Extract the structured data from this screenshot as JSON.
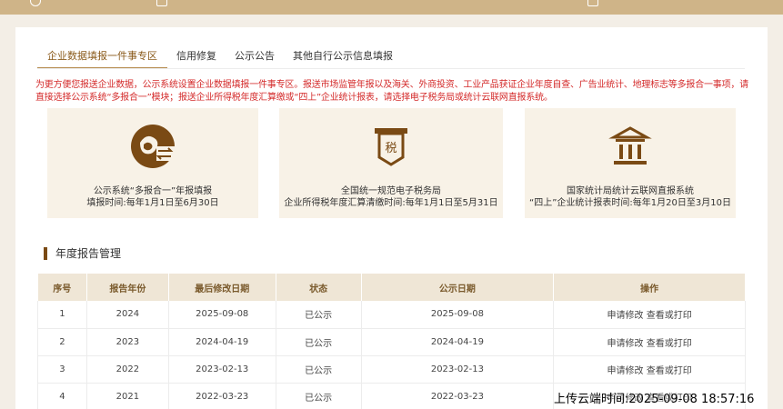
{
  "tabs": [
    "企业数据填报一件事专区",
    "信用修复",
    "公示公告",
    "其他自行公示信息填报"
  ],
  "notice": "为更方便您报送企业数据，公示系统设置企业数据填报一件事专区。报送市场监管年报以及海关、外商投资、工业产品获证企业年度自查、广告业统计、地理标志等多报合一事项，请直接选择公示系统“多报合一”模块；报送企业所得税年度汇算缴或“四上”企业统计报表，请选择电子税务局或统计云联网直报系统。",
  "services": [
    {
      "icon": "multi-report-icon",
      "line1": "公示系统“多报合一”年报填报",
      "line2": "填报时间:每年1月1日至6月30日"
    },
    {
      "icon": "tax-icon",
      "line1": "全国统一规范电子税务局",
      "line2": "企业所得税年度汇算清缴时间:每年1月1日至5月31日"
    },
    {
      "icon": "statistics-bureau-icon",
      "line1": "国家统计局统计云联网直报系统",
      "line2": "“四上”企业统计报表时间:每年1月20日至3月10日"
    }
  ],
  "section_title": "年度报告管理",
  "table": {
    "headers": [
      "序号",
      "报告年份",
      "最后修改日期",
      "状态",
      "公示日期",
      "操作"
    ],
    "rows": [
      {
        "no": "1",
        "year": "2024",
        "modified": "2025-09-08",
        "status": "已公示",
        "published": "2025-09-08"
      },
      {
        "no": "2",
        "year": "2023",
        "modified": "2024-04-19",
        "status": "已公示",
        "published": "2024-04-19"
      },
      {
        "no": "3",
        "year": "2022",
        "modified": "2023-02-13",
        "status": "已公示",
        "published": "2023-02-13"
      },
      {
        "no": "4",
        "year": "2021",
        "modified": "2022-03-23",
        "status": "已公示",
        "published": "2022-03-23"
      }
    ],
    "action_modify": "申请修改",
    "action_view": "查看或打印"
  },
  "overlay": "上传云端时间:2025-09-08 18:57:16",
  "colors": {
    "accent": "#b58a4c",
    "notice": "#d42b2b",
    "card_bg": "#f8f2e7",
    "header_bg": "#efe6d6"
  }
}
